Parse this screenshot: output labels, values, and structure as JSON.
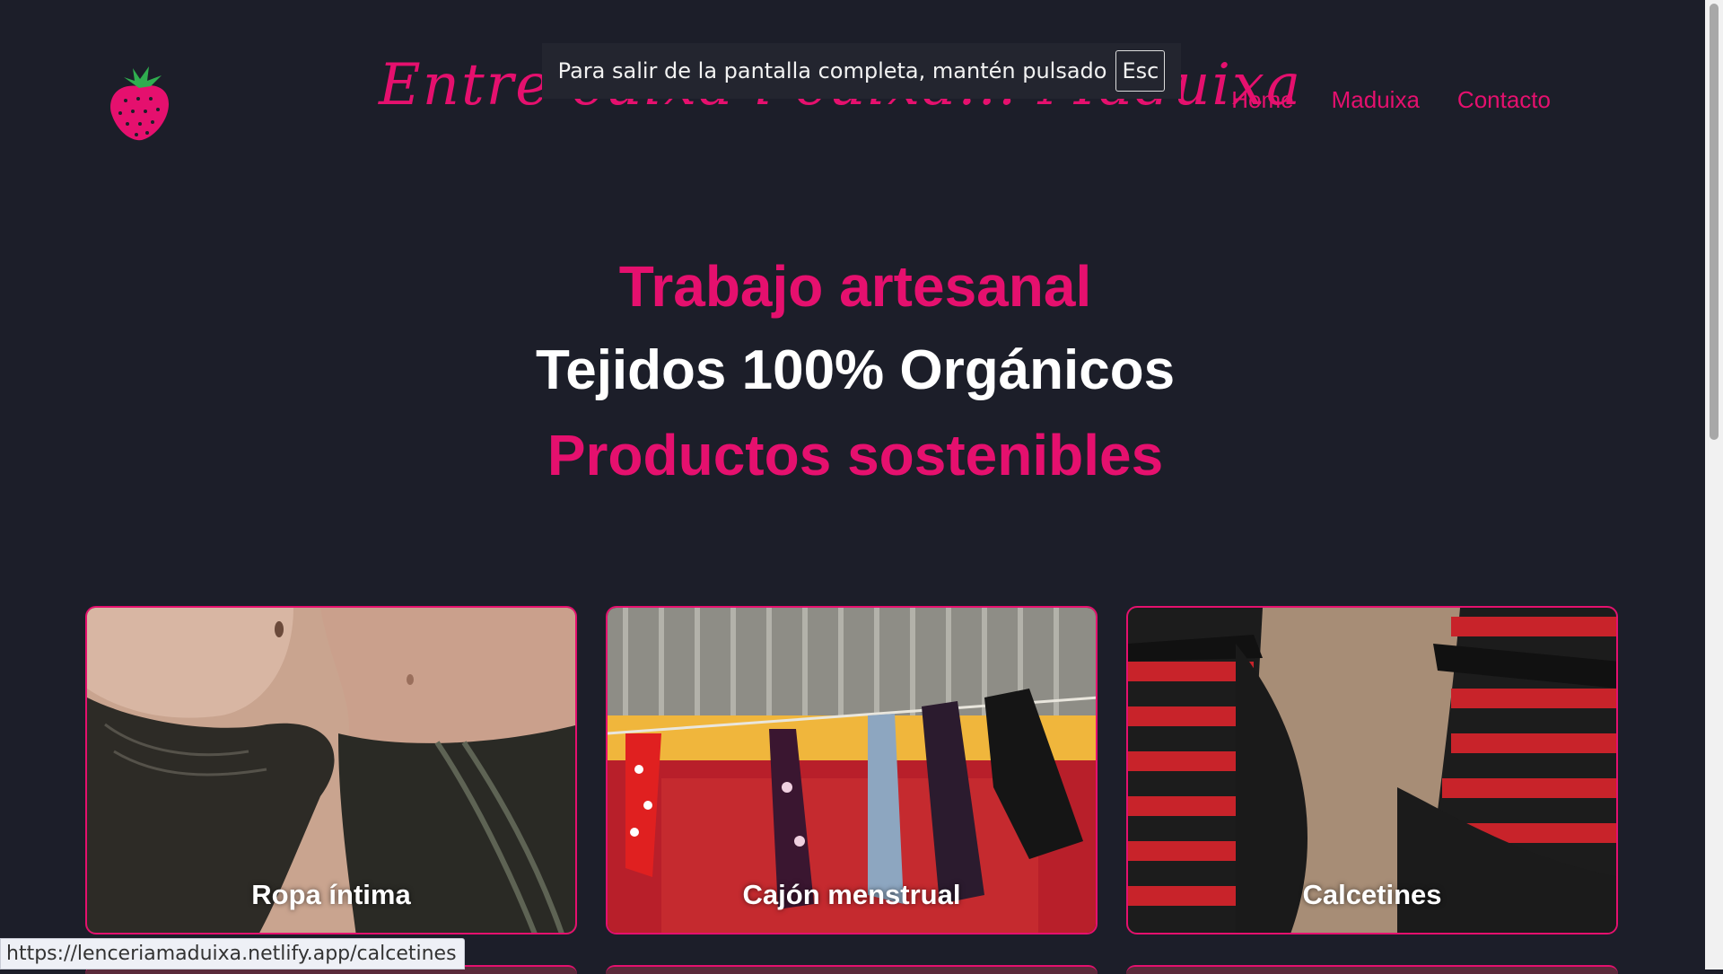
{
  "header": {
    "brand": "Entre cuixa i cuixa... Maduixa",
    "nav": [
      "Home",
      "Maduixa",
      "Contacto"
    ]
  },
  "fullscreen_notice": {
    "text": "Para salir de la pantalla completa, mantén pulsado",
    "key": "Esc"
  },
  "hero": {
    "line1": "Trabajo artesanal",
    "line2": "Tejidos 100% Orgánicos",
    "line3": "Productos sostenibles"
  },
  "cards": [
    {
      "label": "Ropa íntima"
    },
    {
      "label": "Cajón menstrual"
    },
    {
      "label": "Calcetines"
    }
  ],
  "status_url": "https://lenceriamaduixa.netlify.app/calcetines",
  "colors": {
    "background": "#1c1e29",
    "accent": "#e5106e"
  },
  "icons": {
    "logo": "strawberry-icon"
  }
}
